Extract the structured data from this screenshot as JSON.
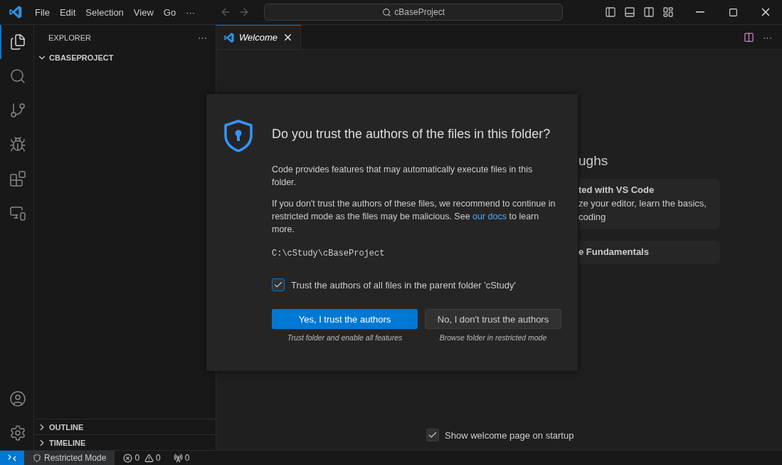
{
  "menu": [
    "File",
    "Edit",
    "Selection",
    "View",
    "Go",
    "···"
  ],
  "command_center": {
    "label": "cBaseProject"
  },
  "activity_bar": [
    {
      "kind": "files",
      "selected": true
    },
    {
      "kind": "search",
      "selected": false
    },
    {
      "kind": "source",
      "selected": false
    },
    {
      "kind": "debug",
      "selected": false
    },
    {
      "kind": "extensions",
      "selected": false
    },
    {
      "kind": "remote",
      "selected": false
    }
  ],
  "sidebar": {
    "title": "EXPLORER",
    "more": "···",
    "sections": [
      {
        "label": "CBASEPROJECT",
        "expanded": true
      },
      {
        "label": "OUTLINE",
        "expanded": false
      },
      {
        "label": "TIMELINE",
        "expanded": false
      }
    ]
  },
  "tabs": [
    {
      "label": "Welcome",
      "selected": true
    }
  ],
  "editor_more": "···",
  "welcome": {
    "heading": "ughs",
    "cards": [
      {
        "title": "ted with VS Code",
        "lines": [
          "ze your editor, learn the basics,",
          "coding"
        ]
      },
      {
        "title": "e Fundamentals"
      }
    ],
    "startup": {
      "label": "Show welcome page on startup",
      "checked": true
    }
  },
  "dialog": {
    "title": "Do you trust the authors of the files in this folder?",
    "intro": "Code provides features that may automatically execute files in this folder.",
    "warning_before": "If you don't trust the authors of these files, we recommend to continue in restricted mode as the files may be malicious. See ",
    "link": "our docs",
    "warning_after": " to learn more.",
    "path": "C:\\cStudy\\cBaseProject",
    "parent_trust": {
      "label": "Trust the authors of all files in the parent folder 'cStudy'",
      "checked": true
    },
    "buttons": [
      {
        "kind": "primary",
        "label": "Yes, I trust the authors",
        "caption": "Trust folder and enable all features"
      },
      {
        "kind": "secondary",
        "label": "No, I don't trust the authors",
        "caption": "Browse folder in restricted mode"
      }
    ]
  },
  "status_bar": {
    "mode": "Restricted Mode",
    "errors": "0",
    "warnings": "0",
    "ports": "0"
  }
}
